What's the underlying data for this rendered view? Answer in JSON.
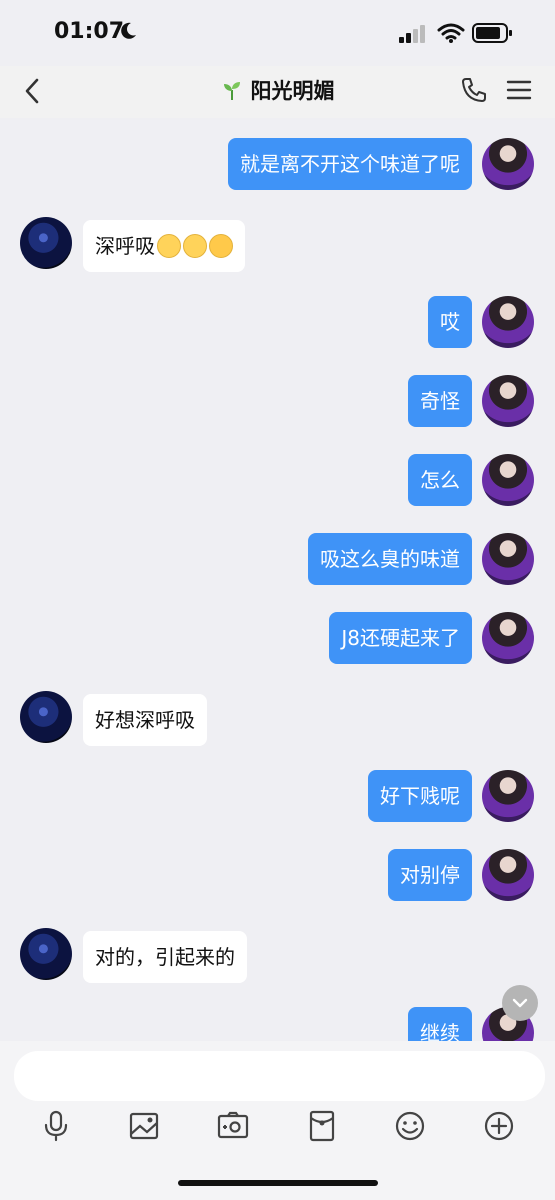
{
  "status_bar": {
    "time": "01:07"
  },
  "header": {
    "title": "阳光明媚"
  },
  "messages": [
    {
      "from": "self",
      "text": "就是离不开这个味道了呢"
    },
    {
      "from": "other",
      "text": "深呼吸",
      "emojis": [
        "relieved-face-emoji",
        "relieved-face-emoji",
        "smiling-face-emoji"
      ]
    },
    {
      "from": "self",
      "text": "哎"
    },
    {
      "from": "self",
      "text": "奇怪"
    },
    {
      "from": "self",
      "text": "怎么"
    },
    {
      "from": "self",
      "text": "吸这么臭的味道"
    },
    {
      "from": "self",
      "text": "J8还硬起来了"
    },
    {
      "from": "other",
      "text": "好想深呼吸"
    },
    {
      "from": "self",
      "text": "好下贱呢"
    },
    {
      "from": "self",
      "text": "对别停"
    },
    {
      "from": "other",
      "text": "对的，引起来的"
    },
    {
      "from": "self",
      "text": "继续"
    }
  ],
  "input": {
    "value": "",
    "placeholder": ""
  },
  "toolbar": {
    "icons": [
      "microphone-icon",
      "image-icon",
      "camera-icon",
      "red-packet-icon",
      "emoji-icon",
      "plus-icon"
    ]
  },
  "colors": {
    "self_bubble": "#3f93f7",
    "other_bubble": "#ffffff",
    "background": "#efeff3"
  }
}
